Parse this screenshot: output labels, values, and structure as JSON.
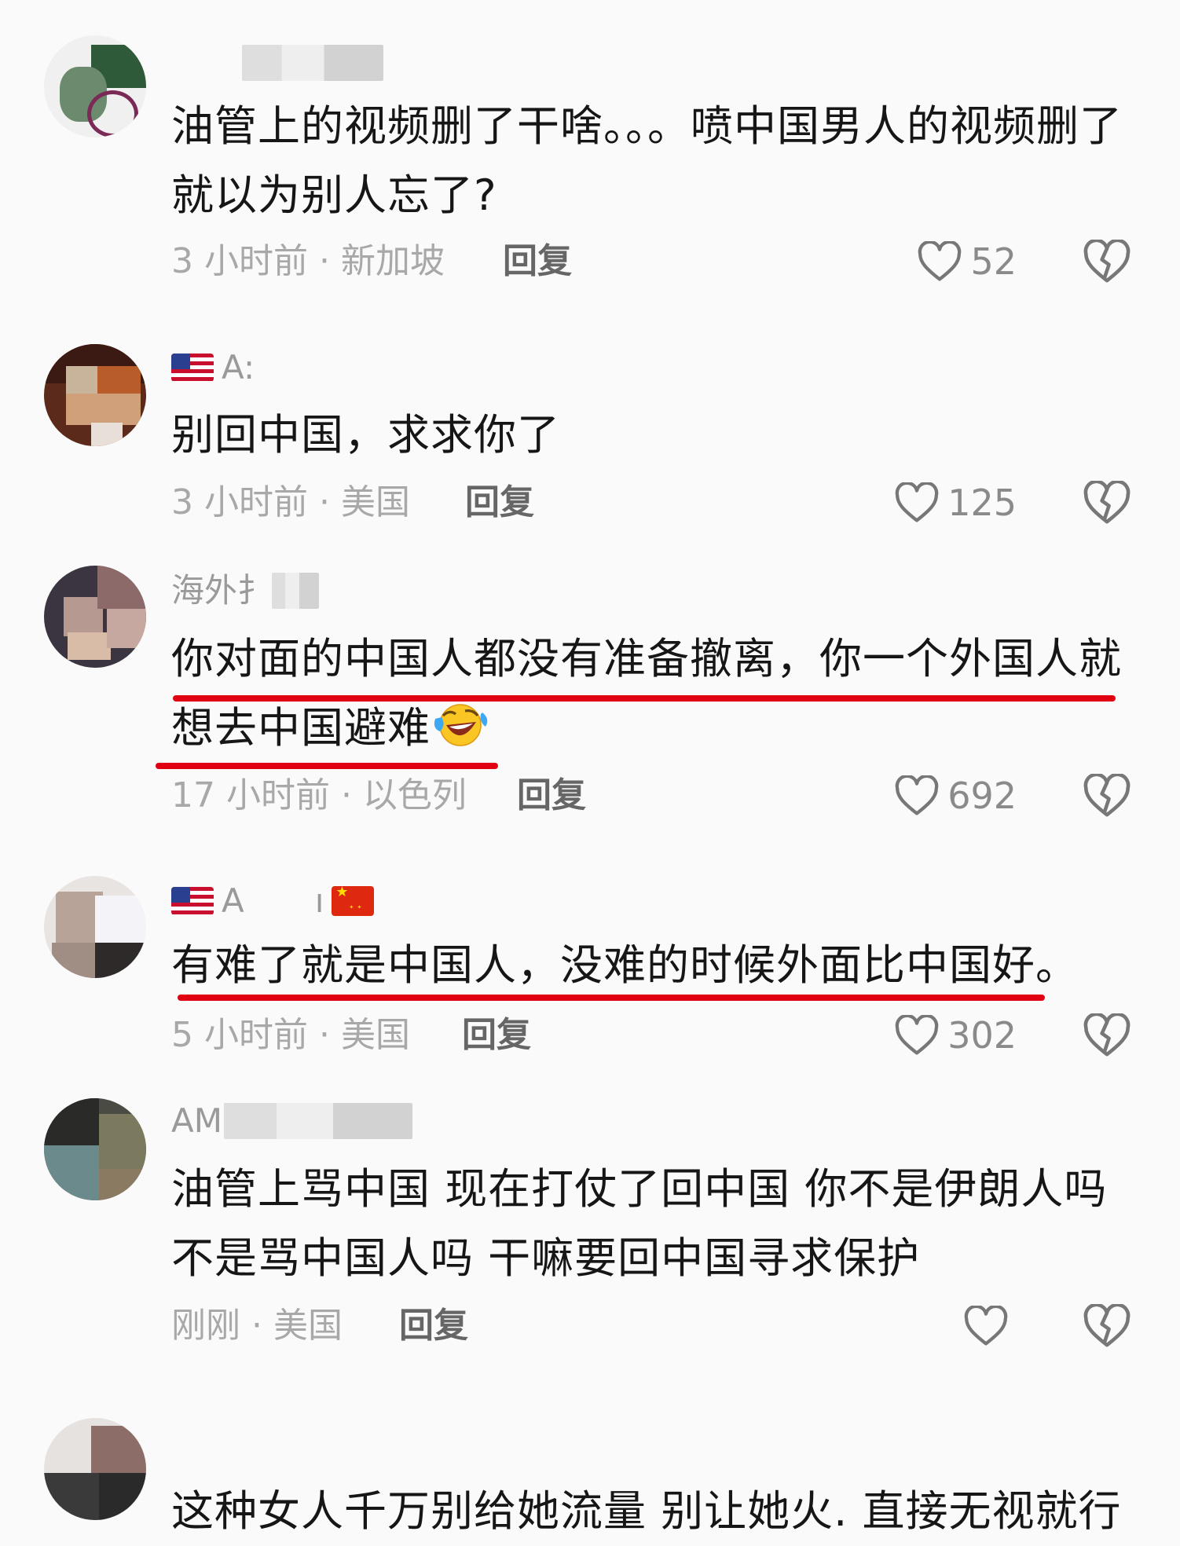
{
  "comments": [
    {
      "username": "",
      "text": "油管上的视频删了干啥。。。喷中国男人的视频删了就以为别人忘了?",
      "time_location": "3 小时前 · 新加坡",
      "reply_label": "回复",
      "likes": "52"
    },
    {
      "username": "A:",
      "text": "别回中国，求求你了",
      "time_location": "3 小时前 · 美国",
      "reply_label": "回复",
      "likes": "125"
    },
    {
      "username": "海外扌",
      "text_line1": "你对面的中国人都没有准备撤离，你一个外国人就",
      "text_line2": "想去中国避难",
      "time_location": "17 小时前 · 以色列",
      "reply_label": "回复",
      "likes": "692"
    },
    {
      "username_a": "A",
      "username_b": "ı",
      "text": "有难了就是中国人，没难的时候外面比中国好。",
      "time_location": "5 小时前 · 美国",
      "reply_label": "回复",
      "likes": "302"
    },
    {
      "username": "AM",
      "text_line1": "油管上骂中国 现在打仗了回中国 你不是伊朗人吗",
      "text_line2": "不是骂中国人吗 干嘛要回中国寻求保护",
      "time_location": "刚刚 · 美国",
      "reply_label": "回复",
      "likes": ""
    },
    {
      "text": "这种女人千万别给她流量 别让她火. 直接无视就行"
    }
  ],
  "colors": {
    "underline": "#e00012",
    "secondary_text": "#a8a8a8",
    "reply_text": "#666666"
  },
  "icons": {
    "like": "heart-outline-icon",
    "dislike": "broken-heart-icon",
    "emoji": "laughing-crying-emoji"
  }
}
